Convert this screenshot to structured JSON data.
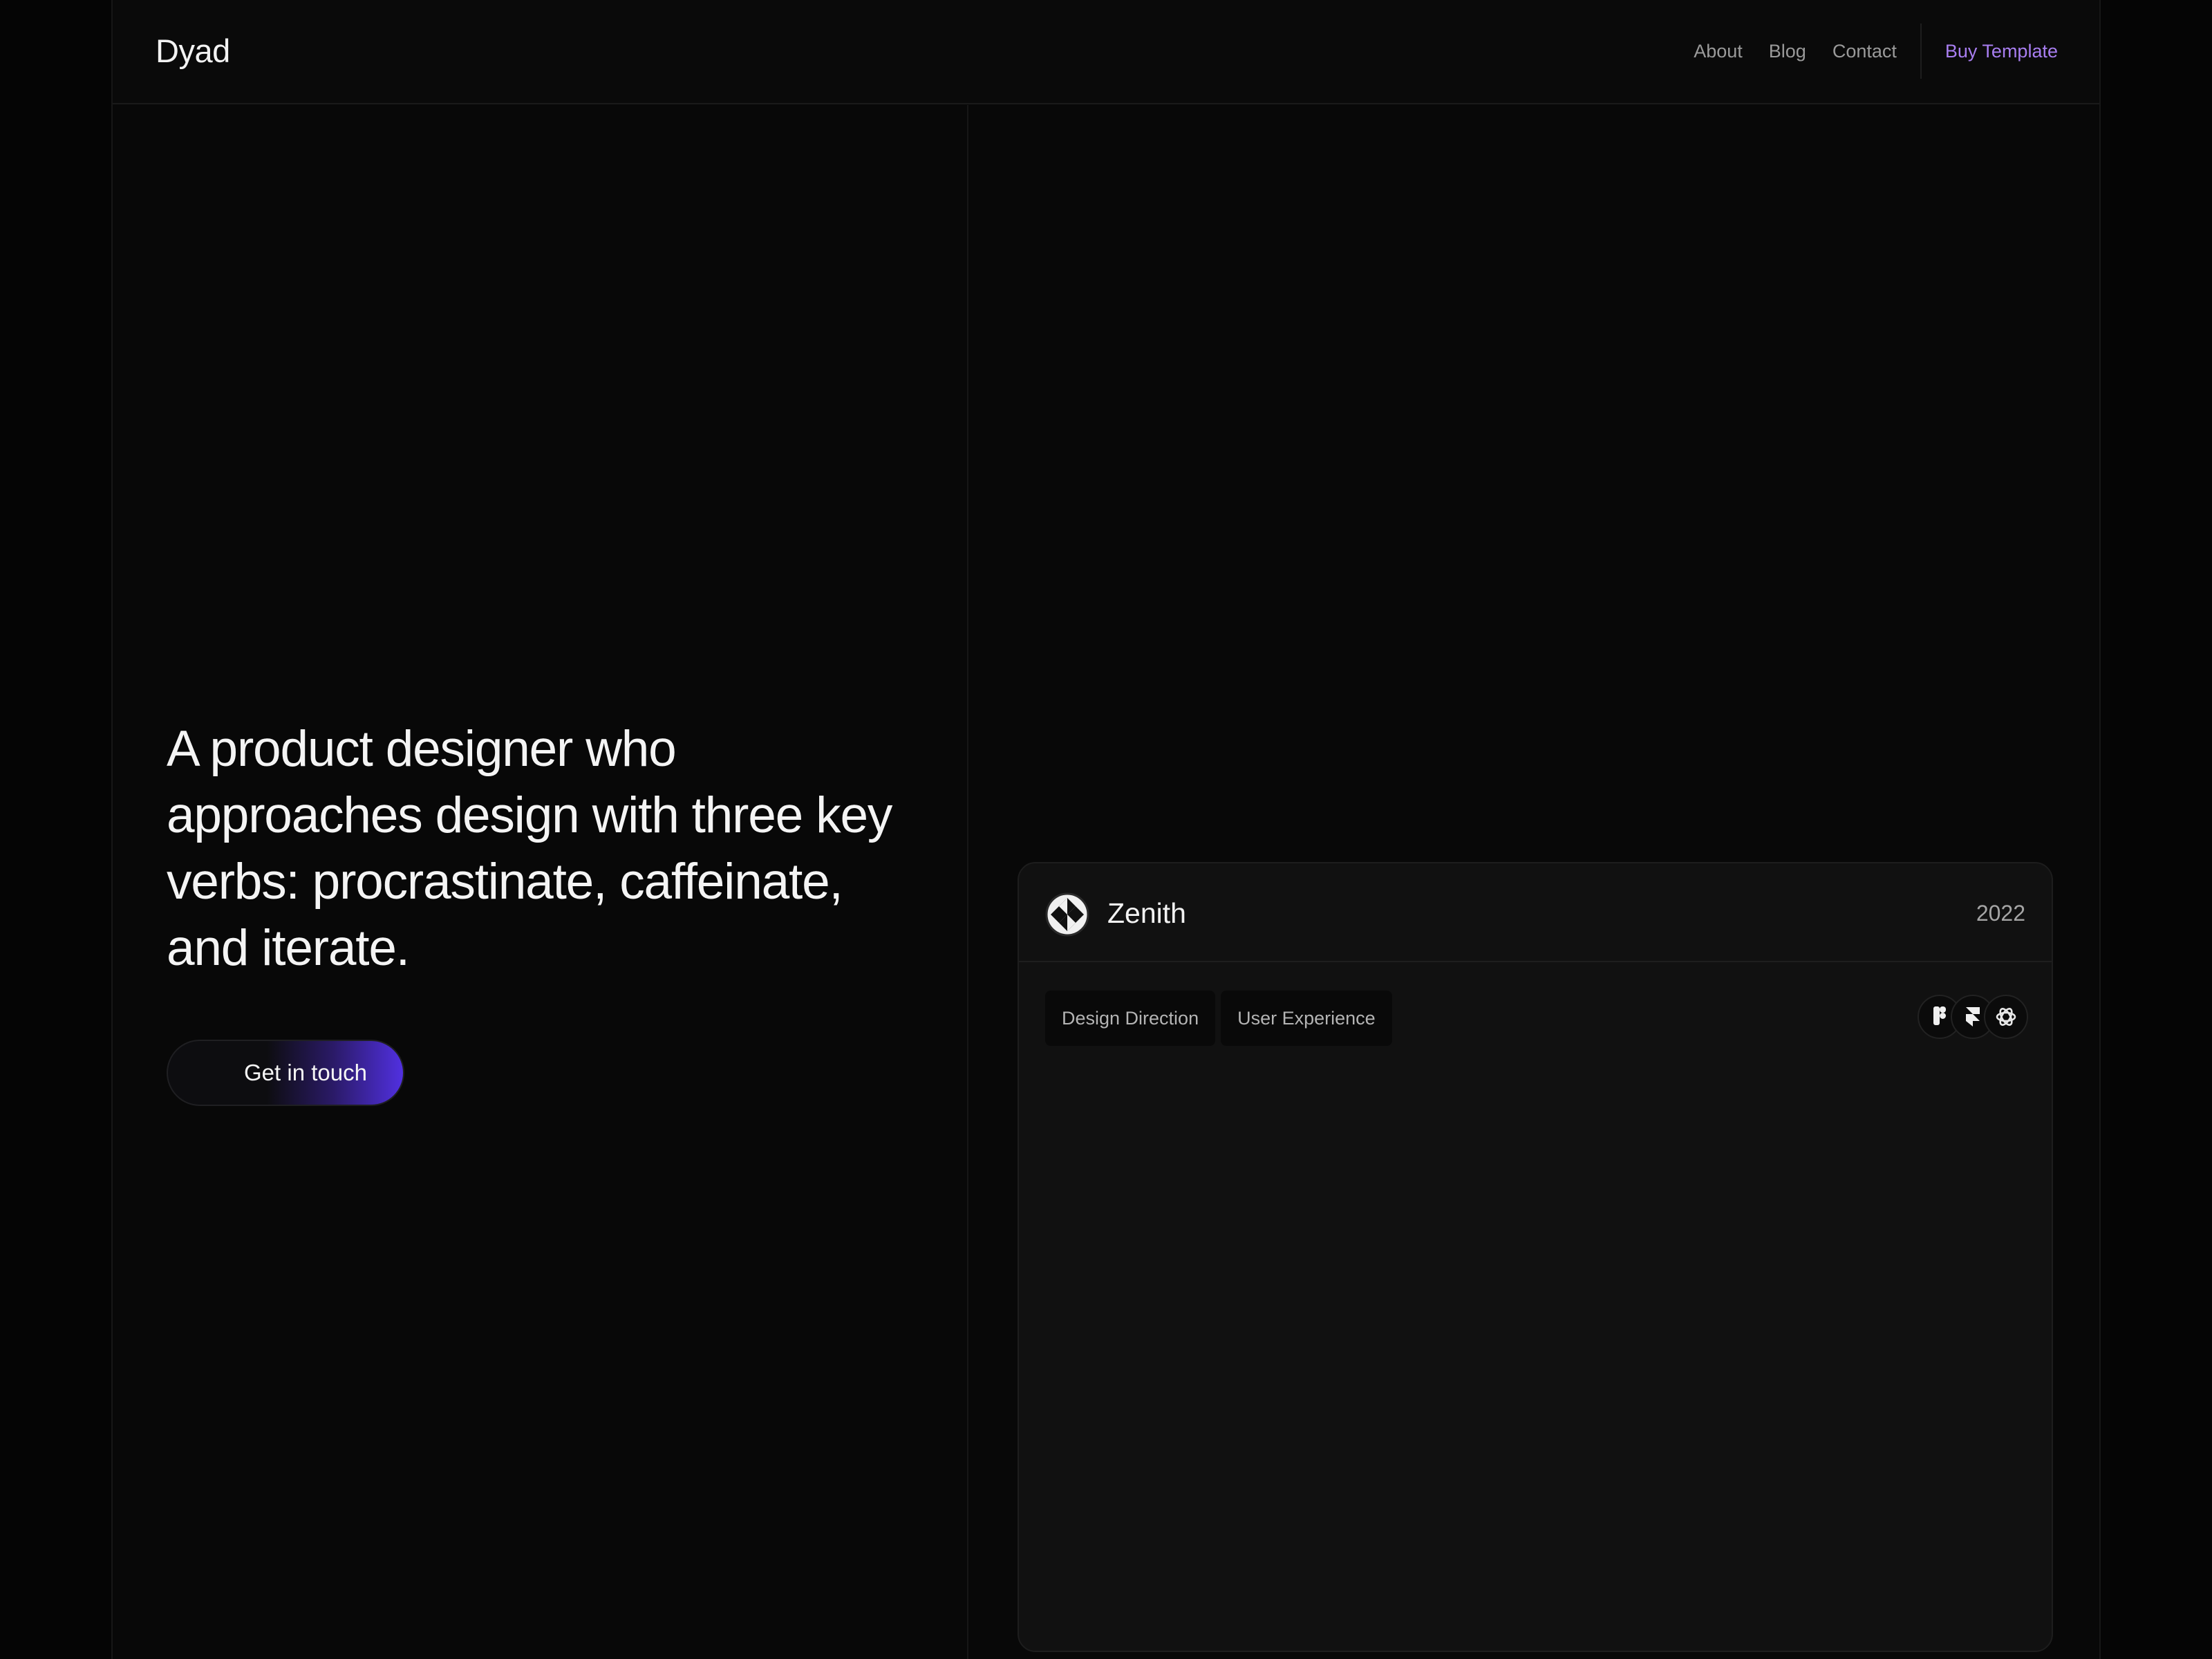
{
  "header": {
    "logo": "Dyad",
    "nav": [
      "About",
      "Blog",
      "Contact"
    ],
    "buy_label": "Buy Template"
  },
  "hero": {
    "title": "A product designer who approaches design with three key verbs: procrastinate, caffeinate, and iterate.",
    "cta_label": "Get in touch"
  },
  "project": {
    "name": "Zenith",
    "year": "2022",
    "tags": [
      "Design Direction",
      "User Experience"
    ],
    "tools": [
      "figma-icon",
      "framer-icon",
      "openai-icon"
    ]
  },
  "colors": {
    "background": "#080808",
    "accent": "#a87ef0",
    "cta_gradient_end": "#5130e0",
    "card": "#111111"
  }
}
